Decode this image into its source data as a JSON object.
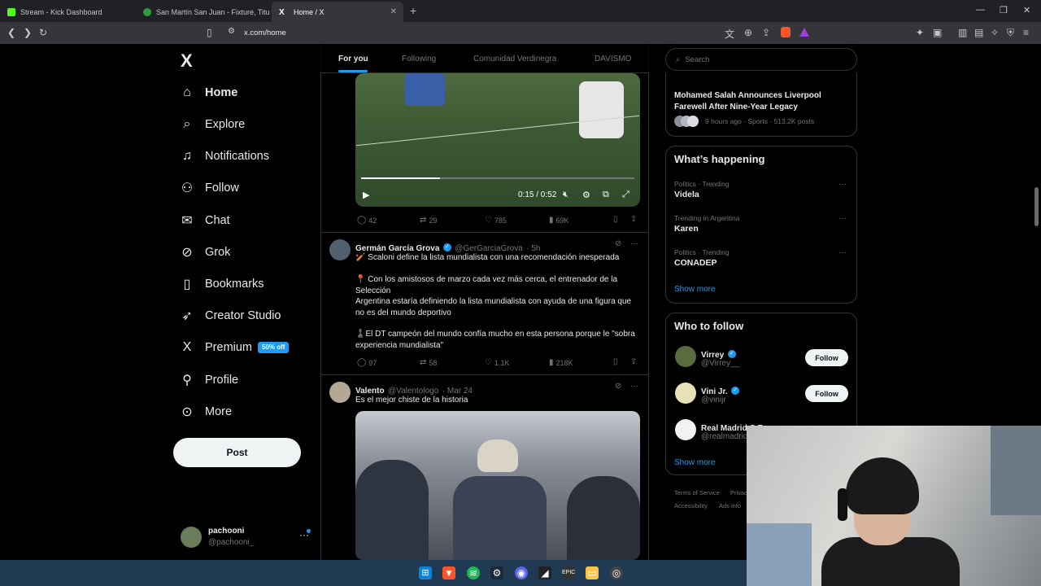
{
  "browser": {
    "tabs": [
      {
        "title": "Stream - Kick Dashboard",
        "color": "#53fc18"
      },
      {
        "title": "San Martín San Juan - Fixture, Titulos",
        "color": "#2e9d3a"
      },
      {
        "title": "Home / X",
        "color": "#ffffff"
      }
    ],
    "url": "x.com/home",
    "new_tab": "+"
  },
  "nav": {
    "logo": "X",
    "items": [
      {
        "label": "Home",
        "icon": "home-icon",
        "glyph": "⌂"
      },
      {
        "label": "Explore",
        "icon": "search-icon",
        "glyph": "⌕"
      },
      {
        "label": "Notifications",
        "icon": "bell-icon",
        "glyph": "♫"
      },
      {
        "label": "Follow",
        "icon": "person-plus-icon",
        "glyph": "⚇"
      },
      {
        "label": "Chat",
        "icon": "mail-icon",
        "glyph": "✉"
      },
      {
        "label": "Grok",
        "icon": "grok-icon",
        "glyph": "⊘"
      },
      {
        "label": "Bookmarks",
        "icon": "bookmark-icon",
        "glyph": "▯"
      },
      {
        "label": "Creator Studio",
        "icon": "rocket-icon",
        "glyph": "➶"
      },
      {
        "label": "Premium",
        "icon": "x-premium-icon",
        "glyph": "X"
      },
      {
        "label": "Profile",
        "icon": "person-icon",
        "glyph": "⚲"
      },
      {
        "label": "More",
        "icon": "more-circle-icon",
        "glyph": "⊙"
      }
    ],
    "premium_badge": "50% off",
    "post_button": "Post",
    "profile": {
      "name": "pachooni",
      "handle": "@pachooni_"
    }
  },
  "feed": {
    "tabs": [
      "For you",
      "Following",
      "Comunidad Verdinegra",
      "DAVISMO"
    ],
    "video": {
      "time": "0:15 / 0:52",
      "progress": 0.29
    },
    "post1_actions": {
      "replies": "42",
      "reposts": "29",
      "likes": "785",
      "views": "69K"
    },
    "post2": {
      "name": "Germán García Grova",
      "handle": "@GerGarciaGrova",
      "time": "· 5h",
      "line1": "🏏 Scaloni define la lista mundialista con una recomendación inesperada",
      "line2": "📍 Con los amistosos de marzo cada vez más cerca, el entrenador de la Selección",
      "line3": "Argentina estaría definiendo la lista mundialista con ayuda de una figura que no es del mundo deportivo",
      "line4": "♟️El DT campeón del mundo confía mucho en esta persona porque le \"sobra experiencia mundialista\"",
      "replies": "97",
      "reposts": "58",
      "likes": "1.1K",
      "views": "218K"
    },
    "post3": {
      "name": "Valento",
      "handle": "@Valentologo",
      "time": "· Mar 24",
      "text": "Es el mejor chiste de la historia"
    }
  },
  "sidebar": {
    "search_placeholder": "Search",
    "news": {
      "title": "Mohamed Salah Announces Liverpool Farewell After Nine-Year Legacy",
      "meta": "9 hours ago · Sports · 513.2K posts"
    },
    "happening_title": "What’s happening",
    "trends": [
      {
        "context": "Politics · Trending",
        "name": "Videla"
      },
      {
        "context": "Trending in Argentina",
        "name": "Karen"
      },
      {
        "context": "Politics · Trending",
        "name": "CONADEP"
      }
    ],
    "show_more": "Show more",
    "who_to_follow_title": "Who to follow",
    "follow": [
      {
        "name": "Virrey",
        "handle": "@Virrey__",
        "color": "#5a6b3e"
      },
      {
        "name": "Vini Jr.",
        "handle": "@vinijr",
        "color": "#e8e1b8"
      },
      {
        "name": "Real Madrid C.F.",
        "handle": "@realmadrid",
        "color": "#f2f2f2"
      }
    ],
    "follow_button": "Follow",
    "footer": [
      "Terms of Service",
      "Privacy",
      "Accessibility",
      "Ads info"
    ]
  }
}
